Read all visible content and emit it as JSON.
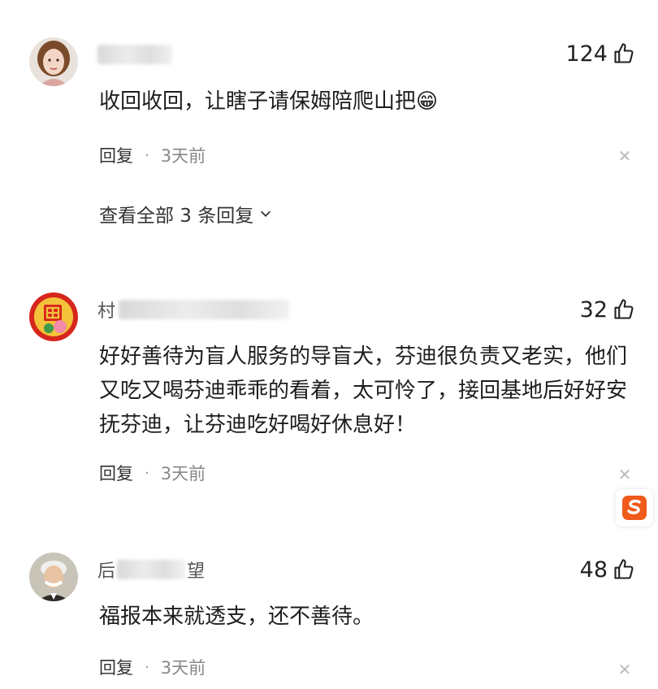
{
  "comments": [
    {
      "username_visible": "",
      "likes": "124",
      "text": "收回收回，让瞎子请保姆陪爬山把😁",
      "reply_label": "回复",
      "time": "3天前",
      "view_replies": "查看全部 3 条回复"
    },
    {
      "username_visible": "村",
      "likes": "32",
      "text": "好好善待为盲人服务的导盲犬，芬迪很负责又老实，他们又吃又喝芬迪乖乖的看着，太可怜了，接回基地后好好安抚芬迪，让芬迪吃好喝好休息好！",
      "reply_label": "回复",
      "time": "3天前"
    },
    {
      "username_visible": "后",
      "username_tail": "望",
      "likes": "48",
      "text": "福报本来就透支，还不善待。",
      "reply_label": "回复",
      "time": "3天前"
    }
  ],
  "icons": {
    "like": "thumbs-up-icon",
    "close": "close-icon",
    "chevron": "chevron-down-icon",
    "logo": "sogou-logo-icon"
  },
  "colors": {
    "text": "#1d1d1d",
    "meta": "#888888",
    "logo_orange": "#f05a1a"
  }
}
